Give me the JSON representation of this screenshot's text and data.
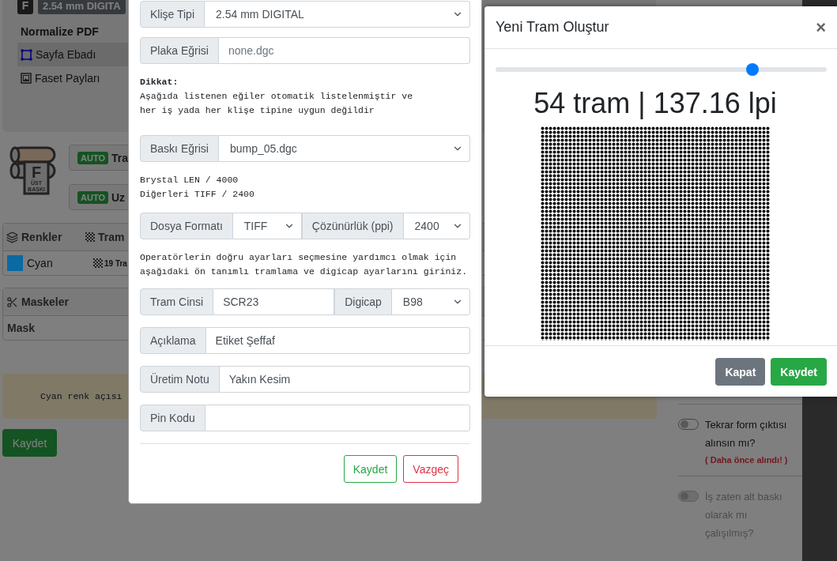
{
  "background_page": {
    "header_card": {
      "badge": "F",
      "plate_type": "2.54 mm DIGITA",
      "title": "Normalize PDF",
      "menu": [
        {
          "label": "Sayfa Ebadı",
          "selected": true,
          "kind": "page"
        },
        {
          "label": "Faset Payları",
          "selected": false,
          "kind": "image"
        }
      ]
    },
    "logo": {
      "letter": "F",
      "line_1": "ÜST",
      "line_2": "BASKI"
    },
    "auto_buttons": [
      {
        "badge": "AUTO",
        "label": "Tra"
      },
      {
        "badge": "AUTO",
        "label": "Uz"
      }
    ],
    "colors_table": {
      "columns": [
        "Renkler",
        "Tram"
      ],
      "rows": [
        {
          "name": "Cyan",
          "color": "#0b69a3",
          "tram": "19 Tra"
        }
      ]
    },
    "masks_table": {
      "title": "Maskeler",
      "columns": [
        "Mask"
      ]
    },
    "alert": "Cyan renk açısı",
    "save_button": "Kaydet",
    "options": [
      {
        "label": "Tekrar form çıktısı alınsın mı?",
        "note": "( Daha önce alındı! )",
        "on": false,
        "disabled": false
      },
      {
        "label": "İş zaten alt baskı olarak mı çalışılmış?",
        "on": false,
        "disabled": true
      }
    ]
  },
  "plate_modal": {
    "plate_row": {
      "label": "Klişe Tipi",
      "value": "2.54 mm DIGITAL"
    },
    "plate_curve": {
      "label": "Plaka Eğrisi",
      "placeholder": "none.dgc"
    },
    "warning": {
      "title": "Dikkat:",
      "lines": [
        "Aşağıda listenen eğiler otomatik listelenmiştir ve",
        "her iş yada her klişe tipine uygun değildir"
      ]
    },
    "print_curve": {
      "label": "Baskı Eğrisi",
      "value": "bump_05.dgc"
    },
    "format_note": [
      "Brystal LEN / 4000",
      "Diğerleri TIFF / 2400"
    ],
    "file_format": {
      "label": "Dosya Formatı",
      "value": "TIFF"
    },
    "resolution": {
      "label": "Çözünürlük (ppi)",
      "value": "2400"
    },
    "operator_note": [
      "Operatörlerin doğru ayarları seçmesine yardımcı olmak için",
      "aşağıdaki ön tanımlı tramlama ve digicap ayarlarını giriniz."
    ],
    "screen_type": {
      "label": "Tram Cinsi",
      "value": "SCR23"
    },
    "digicap": {
      "label": "Digicap",
      "value": "B98"
    },
    "fields": [
      {
        "label": "Açıklama",
        "value": "Etiket Şeffaf"
      },
      {
        "label": "Üretim Notu",
        "value": "Yakın Kesim"
      },
      {
        "label": "Pin Kodu"
      }
    ],
    "buttons": {
      "save": "Kaydet",
      "cancel": "Vazgeç"
    }
  },
  "tram_modal": {
    "title": "Yeni Tram Oluştur",
    "close": "×",
    "slider": {
      "level": 0.776
    },
    "reading": "54 tram | 137.16 lpi",
    "buttons": {
      "close": "Kapat",
      "save": "Kaydet"
    }
  }
}
